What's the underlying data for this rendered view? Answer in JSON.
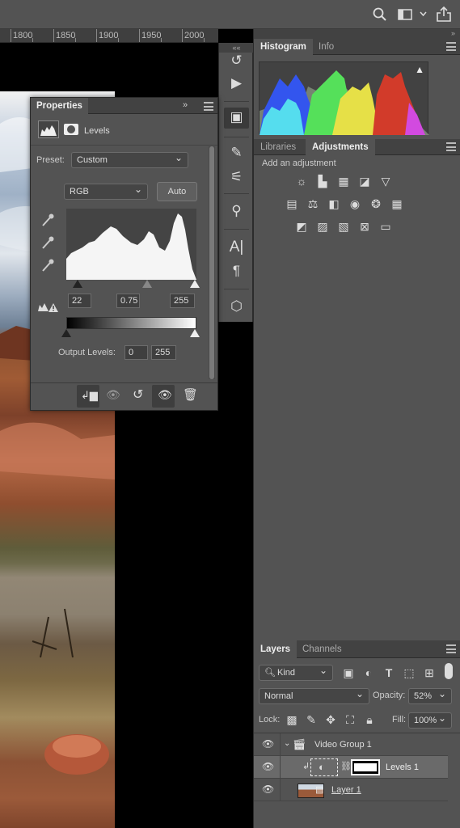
{
  "topbar": {
    "icons": [
      "search-icon",
      "workspace-icon",
      "chevron-down-icon",
      "share-icon"
    ]
  },
  "ruler": {
    "labels": [
      "1800",
      "1850",
      "1900",
      "1950",
      "2000"
    ]
  },
  "panel_collapse": "««",
  "histogram_panel": {
    "tabs": [
      "Histogram",
      "Info"
    ],
    "warning": "▲"
  },
  "adjustments_panel": {
    "tabs": [
      "Libraries",
      "Adjustments"
    ],
    "hint": "Add an adjustment"
  },
  "properties": {
    "tab": "Properties",
    "collapse": "»",
    "title": "Levels",
    "preset_label": "Preset:",
    "preset_value": "Custom",
    "channel_value": "RGB",
    "auto_label": "Auto",
    "input_black": "22",
    "input_gamma": "0.75",
    "input_white": "255",
    "output_label": "Output Levels:",
    "output_black": "0",
    "output_white": "255"
  },
  "layers_panel": {
    "tabs": [
      "Layers",
      "Channels"
    ],
    "kind_label": "Kind",
    "blend_mode": "Normal",
    "opacity_label": "Opacity:",
    "opacity_value": "52%",
    "lock_label": "Lock:",
    "fill_label": "Fill:",
    "fill_value": "100%",
    "layers": [
      {
        "name": "Video Group 1",
        "type": "group"
      },
      {
        "name": "Levels 1",
        "type": "adjustment"
      },
      {
        "name": "Layer 1",
        "type": "video"
      }
    ]
  }
}
